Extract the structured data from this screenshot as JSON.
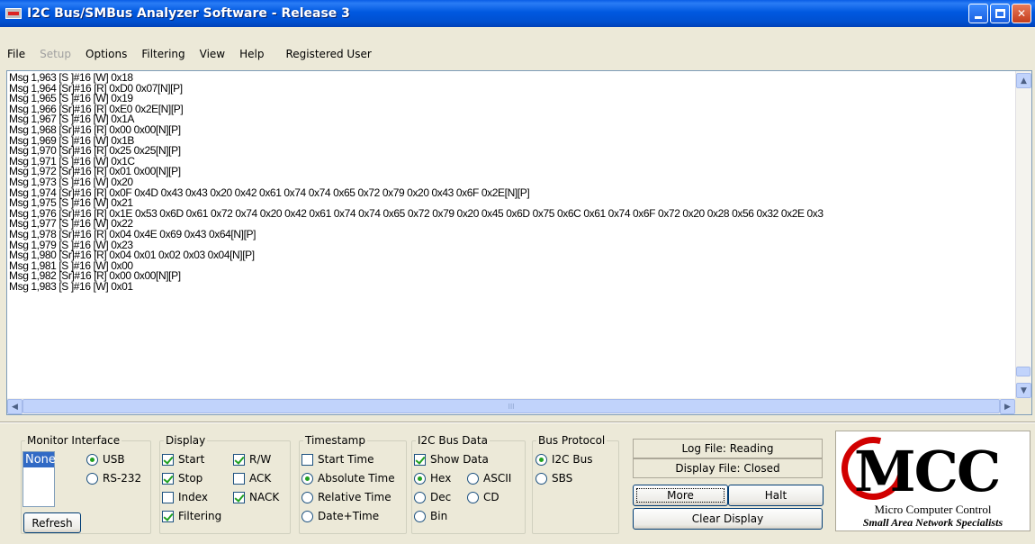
{
  "window": {
    "title": "I2C Bus/SMBus Analyzer Software - Release 3"
  },
  "menu": {
    "file": "File",
    "setup": "Setup",
    "options": "Options",
    "filtering": "Filtering",
    "view": "View",
    "help": "Help",
    "registered": "Registered User"
  },
  "log": {
    "lines": [
      "Msg 1,963 [S ]#16 [W] 0x18",
      "Msg 1,964 [Sr]#16 [R] 0xD0 0x07[N][P]",
      "Msg 1,965 [S ]#16 [W] 0x19",
      "Msg 1,966 [Sr]#16 [R] 0xE0 0x2E[N][P]",
      "Msg 1,967 [S ]#16 [W] 0x1A",
      "Msg 1,968 [Sr]#16 [R] 0x00 0x00[N][P]",
      "Msg 1,969 [S ]#16 [W] 0x1B",
      "Msg 1,970 [Sr]#16 [R] 0x25 0x25[N][P]",
      "Msg 1,971 [S ]#16 [W] 0x1C",
      "Msg 1,972 [Sr]#16 [R] 0x01 0x00[N][P]",
      "Msg 1,973 [S ]#16 [W] 0x20",
      "Msg 1,974 [Sr]#16 [R] 0x0F 0x4D 0x43 0x43 0x20 0x42 0x61 0x74 0x74 0x65 0x72 0x79 0x20 0x43 0x6F 0x2E[N][P]",
      "Msg 1,975 [S ]#16 [W] 0x21",
      "Msg 1,976 [Sr]#16 [R] 0x1E 0x53 0x6D 0x61 0x72 0x74 0x20 0x42 0x61 0x74 0x74 0x65 0x72 0x79 0x20 0x45 0x6D 0x75 0x6C 0x61 0x74 0x6F 0x72 0x20 0x28 0x56 0x32 0x2E 0x3",
      "Msg 1,977 [S ]#16 [W] 0x22",
      "Msg 1,978 [Sr]#16 [R] 0x04 0x4E 0x69 0x43 0x64[N][P]",
      "Msg 1,979 [S ]#16 [W] 0x23",
      "Msg 1,980 [Sr]#16 [R] 0x04 0x01 0x02 0x03 0x04[N][P]",
      "Msg 1,981 [S ]#16 [W] 0x00",
      "Msg 1,982 [Sr]#16 [R] 0x00 0x00[N][P]",
      "Msg 1,983 [S ]#16 [W] 0x01"
    ],
    "hscroll_grip": "III"
  },
  "monitor": {
    "title": "Monitor Interface",
    "list_selected": "None",
    "usb": "USB",
    "rs232": "RS-232",
    "refresh": "Refresh"
  },
  "display": {
    "title": "Display",
    "start": "Start",
    "stop": "Stop",
    "index": "Index",
    "filtering": "Filtering",
    "rw": "R/W",
    "ack": "ACK",
    "nack": "NACK"
  },
  "timestamp": {
    "title": "Timestamp",
    "start_time": "Start Time",
    "absolute": "Absolute Time",
    "relative": "Relative Time",
    "datetime": "Date+Time"
  },
  "busdata": {
    "title": "I2C Bus Data",
    "show_data": "Show Data",
    "hex": "Hex",
    "ascii": "ASCII",
    "dec": "Dec",
    "cd": "CD",
    "bin": "Bin"
  },
  "protocol": {
    "title": "Bus Protocol",
    "i2c": "I2C Bus",
    "sbs": "SBS"
  },
  "controls": {
    "log_file": "Log File: Reading",
    "display_file": "Display File: Closed",
    "more": "More",
    "halt": "Halt",
    "clear": "Clear Display"
  },
  "logo": {
    "mark": "MCC",
    "line1": "Micro Computer Control",
    "line2": "Small Area Network Specialists"
  },
  "colors": {
    "titlebar": "#0054e3",
    "check": "#21a121",
    "logo_red": "#d10000"
  }
}
